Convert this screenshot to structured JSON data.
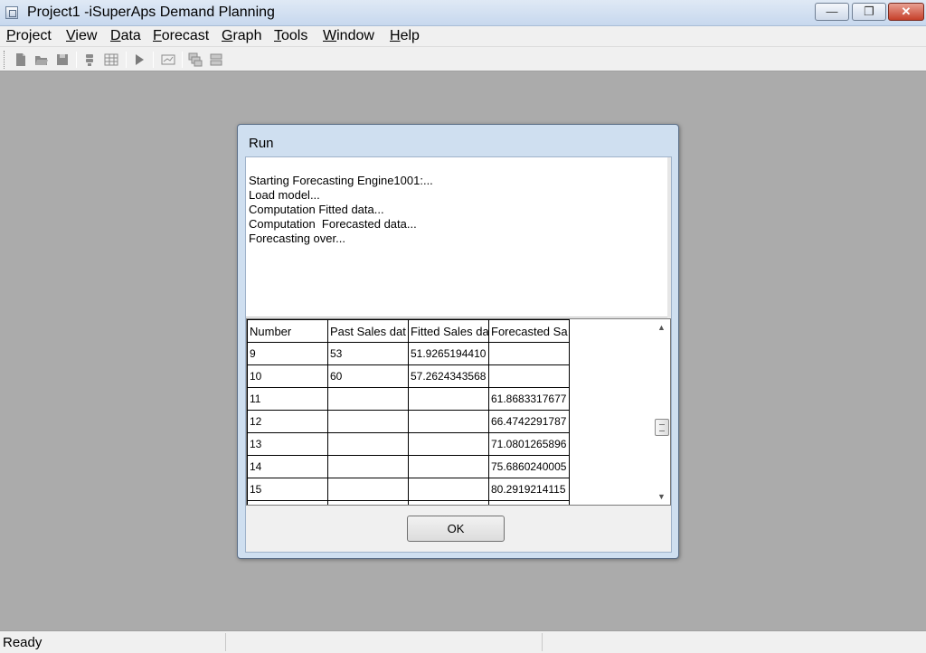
{
  "window": {
    "title": "Project1 -iSuperAps Demand Planning",
    "minimize_symbol": "—",
    "maximize_symbol": "❐",
    "close_symbol": "✕"
  },
  "menu": [
    {
      "label": "Project"
    },
    {
      "label": "View"
    },
    {
      "label": "Data"
    },
    {
      "label": "Forecast"
    },
    {
      "label": "Graph"
    },
    {
      "label": "Tools"
    },
    {
      "label": "Window"
    },
    {
      "label": "Help"
    }
  ],
  "toolbar": {
    "icons": [
      "new-file-icon",
      "open-folder-icon",
      "save-icon",
      "import-icon",
      "table-icon",
      "run-icon",
      "chart-icon",
      "cascade-windows-icon",
      "tile-windows-icon"
    ]
  },
  "dialog": {
    "title": "Run",
    "log": [
      "Starting Forecasting Engine1001:...",
      "Load model...",
      "Computation Fitted data...",
      "Computation  Forecasted data...",
      "Forecasting over..."
    ],
    "table": {
      "headers": [
        "Number",
        "Past Sales dat",
        "Fitted Sales da",
        "Forecasted Sa"
      ],
      "rows": [
        [
          "9",
          "53",
          "51.9265194410",
          ""
        ],
        [
          "10",
          "60",
          "57.2624343568",
          ""
        ],
        [
          "11",
          "",
          "",
          "61.8683317677"
        ],
        [
          "12",
          "",
          "",
          "66.4742291787"
        ],
        [
          "13",
          "",
          "",
          "71.0801265896"
        ],
        [
          "14",
          "",
          "",
          "75.6860240005"
        ],
        [
          "15",
          "",
          "",
          "80.2919214115"
        ]
      ]
    },
    "ok_label": "OK"
  },
  "status": {
    "text": "Ready"
  }
}
